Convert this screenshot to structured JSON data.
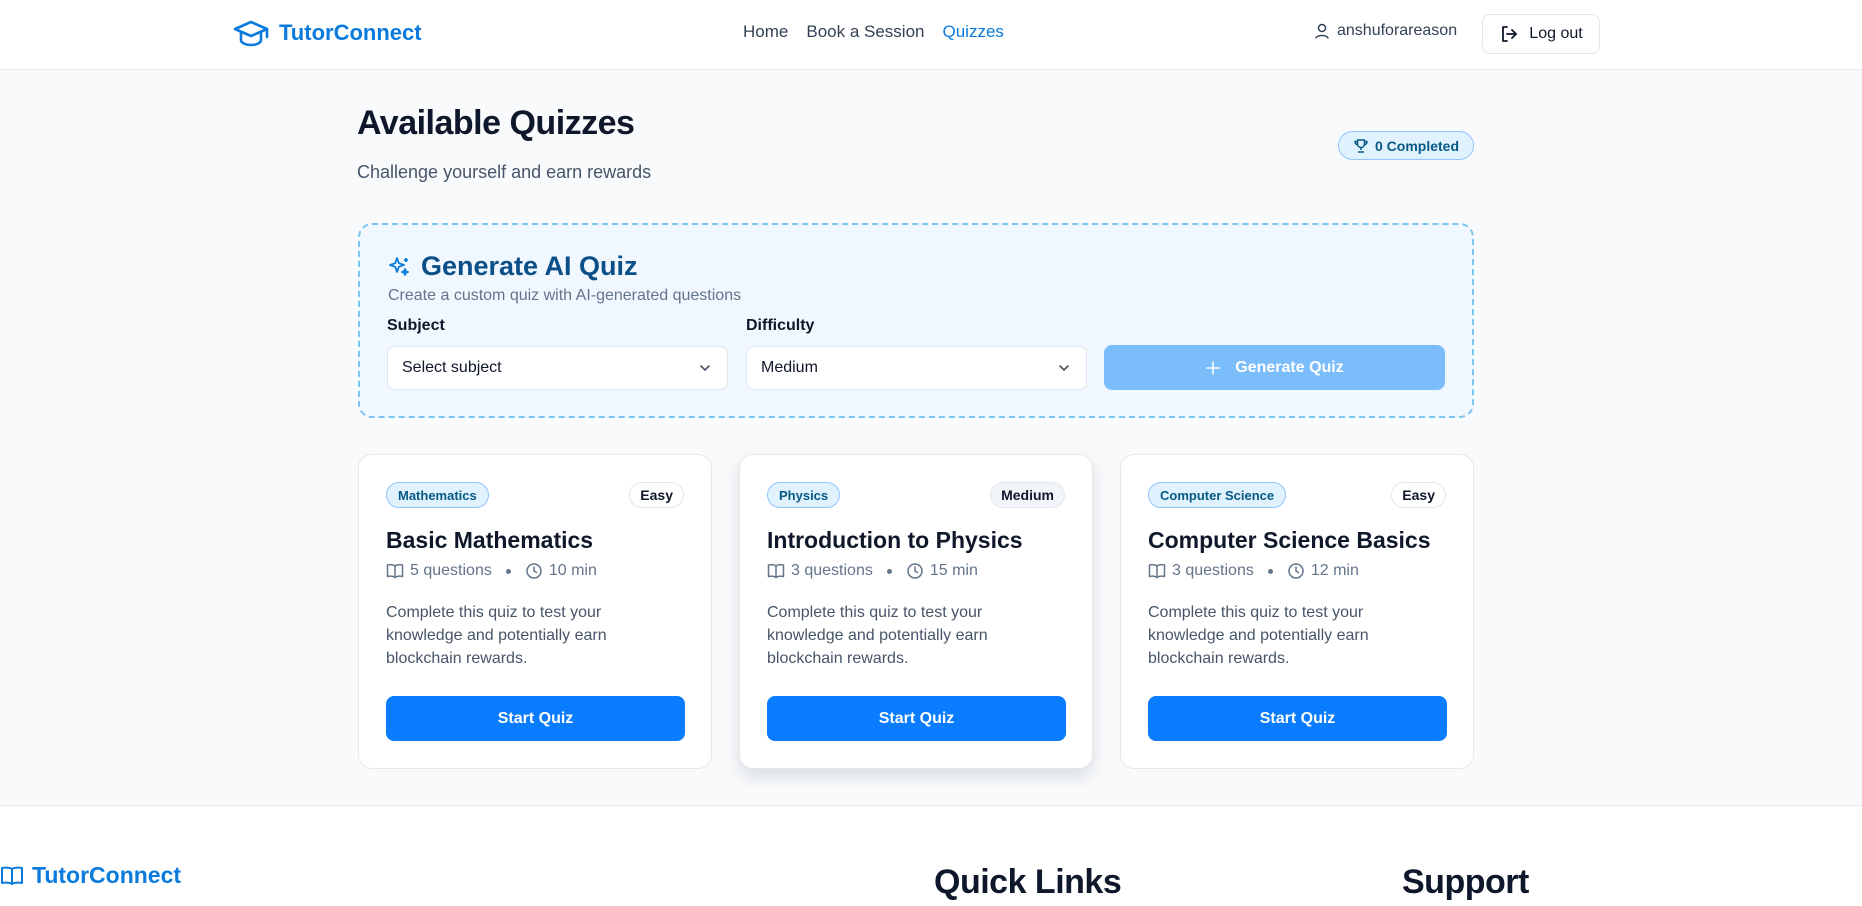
{
  "header": {
    "brand": "TutorConnect",
    "nav": [
      "Home",
      "Book a Session",
      "Quizzes"
    ],
    "active_nav": "Quizzes",
    "username": "anshuforareason",
    "logout_label": "Log out"
  },
  "page": {
    "title": "Available Quizzes",
    "subtitle": "Challenge yourself and earn rewards",
    "completed_badge": "0 Completed"
  },
  "ai_quiz": {
    "title": "Generate AI Quiz",
    "description": "Create a custom quiz with AI-generated questions",
    "subject_label": "Subject",
    "subject_value": "Select subject",
    "difficulty_label": "Difficulty",
    "difficulty_value": "Medium",
    "generate_label": "Generate Quiz"
  },
  "quizzes": [
    {
      "subject": "Mathematics",
      "difficulty": "Easy",
      "title": "Basic Mathematics",
      "questions": "5 questions",
      "duration": "10 min",
      "description": "Complete this quiz to test your knowledge and potentially earn blockchain rewards.",
      "button": "Start Quiz"
    },
    {
      "subject": "Physics",
      "difficulty": "Medium",
      "title": "Introduction to Physics",
      "questions": "3 questions",
      "duration": "15 min",
      "description": "Complete this quiz to test your knowledge and potentially earn blockchain rewards.",
      "button": "Start Quiz"
    },
    {
      "subject": "Computer Science",
      "difficulty": "Easy",
      "title": "Computer Science Basics",
      "questions": "3 questions",
      "duration": "12 min",
      "description": "Complete this quiz to test your knowledge and potentially earn blockchain rewards.",
      "button": "Start Quiz"
    }
  ],
  "footer": {
    "brand": "TutorConnect",
    "quick_links_heading": "Quick Links",
    "support_heading": "Support"
  },
  "colors": {
    "primary": "#0a7cff",
    "brand": "#0a7bdc",
    "generate_disabled": "#7bbcfb"
  }
}
